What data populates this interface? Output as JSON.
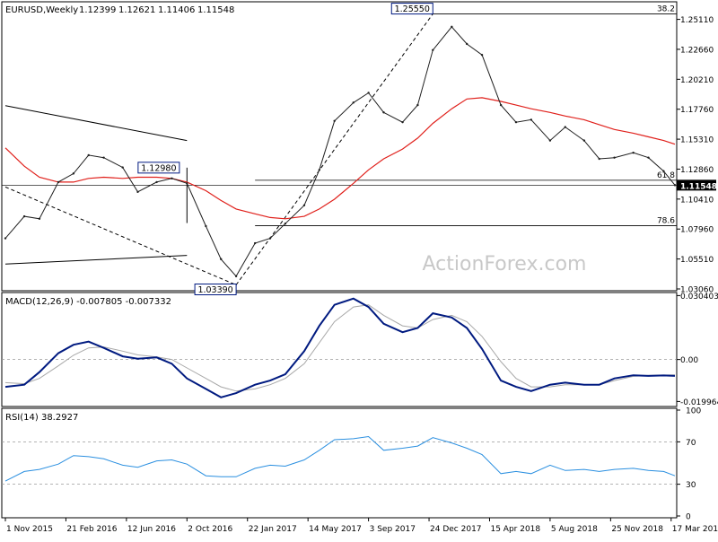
{
  "chart_data": {
    "type": "line",
    "title": "EURUSD,Weekly",
    "ohlc": {
      "open": "1.12399",
      "high": "1.12621",
      "low": "1.11406",
      "close": "1.11548"
    },
    "watermark": "ActionForex.com",
    "colors": {
      "price": "#1f1f1f",
      "sma": "#e0201b",
      "macd": "#001a80",
      "signal": "#a8a8a8",
      "rsi": "#2a8fe0",
      "label_box": "#001a80"
    },
    "x_ticks": [
      "1 Nov 2015",
      "21 Feb 2016",
      "12 Jun 2016",
      "2 Oct 2016",
      "22 Jan 2017",
      "14 May 2017",
      "3 Sep 2017",
      "24 Dec 2017",
      "15 Apr 2018",
      "5 Aug 2018",
      "25 Nov 2018",
      "17 Mar 2019"
    ],
    "x_start": "1 Nov 2015",
    "x_end": "24 Mar 2019",
    "price_panel": {
      "ylim": [
        1.0306,
        1.264
      ],
      "y_ticks": [
        "1.25110",
        "1.22660",
        "1.20210",
        "1.17760",
        "1.15310",
        "1.12860",
        "1.10410",
        "1.07960",
        "1.05510",
        "1.03060"
      ],
      "current_price_label": "1.11548",
      "current_price": 1.11548,
      "fib_levels": [
        {
          "label": "38.2",
          "value": 1.2555
        },
        {
          "label": "61.8",
          "value": 1.1195
        },
        {
          "label": "78.6",
          "value": 1.0823
        }
      ],
      "marked_highs_lows": [
        {
          "label": "1.25550",
          "value": 1.2555,
          "date": "31 Dec 2017"
        },
        {
          "label": "1.12980",
          "value": 1.1298,
          "date": "18 Sep 2016"
        },
        {
          "label": "1.03390",
          "value": 1.0339,
          "date": "1 Jan 2017"
        }
      ],
      "trendlines": [
        {
          "x": [
            "1 Nov 2015",
            "2 Oct 2016"
          ],
          "y": [
            1.1805,
            1.152
          ],
          "style": "solid"
        },
        {
          "x": [
            "1 Nov 2015",
            "2 Oct 2016"
          ],
          "y": [
            1.051,
            1.058
          ],
          "style": "solid"
        },
        {
          "x": [
            "1 Nov 2015",
            "1 Jan 2017"
          ],
          "y": [
            1.114,
            1.0339
          ],
          "style": "dashed"
        },
        {
          "x": [
            "1 Jan 2017",
            "31 Dec 2017"
          ],
          "y": [
            1.0339,
            1.2555
          ],
          "style": "dashed"
        }
      ],
      "resistance_lines": [
        {
          "x": [
            "2 Oct 2016",
            "2 Oct 2016"
          ],
          "y": [
            1.1298,
            1.0845
          ]
        }
      ],
      "close_series": {
        "dates": [
          "1 Nov 2015",
          "6 Dec 2015",
          "3 Jan 2016",
          "7 Feb 2016",
          "6 Mar 2016",
          "3 Apr 2016",
          "1 May 2016",
          "5 Jun 2016",
          "3 Jul 2016",
          "7 Aug 2016",
          "4 Sep 2016",
          "2 Oct 2016",
          "6 Nov 2016",
          "4 Dec 2016",
          "1 Jan 2017",
          "5 Feb 2017",
          "5 Mar 2017",
          "2 Apr 2017",
          "7 May 2017",
          "4 Jun 2017",
          "2 Jul 2017",
          "6 Aug 2017",
          "3 Sep 2017",
          "1 Oct 2017",
          "5 Nov 2017",
          "3 Dec 2017",
          "31 Dec 2017",
          "4 Feb 2018",
          "4 Mar 2018",
          "1 Apr 2018",
          "6 May 2018",
          "3 Jun 2018",
          "1 Jul 2018",
          "5 Aug 2018",
          "2 Sep 2018",
          "7 Oct 2018",
          "4 Nov 2018",
          "2 Dec 2018",
          "6 Jan 2019",
          "3 Feb 2019",
          "3 Mar 2019",
          "24 Mar 2019"
        ],
        "values": [
          1.072,
          1.09,
          1.088,
          1.118,
          1.125,
          1.14,
          1.138,
          1.13,
          1.11,
          1.118,
          1.121,
          1.117,
          1.082,
          1.055,
          1.041,
          1.068,
          1.072,
          1.084,
          1.099,
          1.128,
          1.168,
          1.183,
          1.191,
          1.175,
          1.167,
          1.181,
          1.226,
          1.245,
          1.231,
          1.222,
          1.181,
          1.167,
          1.169,
          1.152,
          1.163,
          1.152,
          1.137,
          1.138,
          1.142,
          1.138,
          1.127,
          1.1155
        ]
      },
      "sma_series": {
        "dates": [
          "1 Nov 2015",
          "6 Dec 2015",
          "3 Jan 2016",
          "7 Feb 2016",
          "6 Mar 2016",
          "3 Apr 2016",
          "1 May 2016",
          "5 Jun 2016",
          "3 Jul 2016",
          "7 Aug 2016",
          "4 Sep 2016",
          "2 Oct 2016",
          "6 Nov 2016",
          "4 Dec 2016",
          "1 Jan 2017",
          "5 Feb 2017",
          "5 Mar 2017",
          "2 Apr 2017",
          "7 May 2017",
          "4 Jun 2017",
          "2 Jul 2017",
          "6 Aug 2017",
          "3 Sep 2017",
          "1 Oct 2017",
          "5 Nov 2017",
          "3 Dec 2017",
          "31 Dec 2017",
          "4 Feb 2018",
          "4 Mar 2018",
          "1 Apr 2018",
          "6 May 2018",
          "3 Jun 2018",
          "1 Jul 2018",
          "5 Aug 2018",
          "2 Sep 2018",
          "7 Oct 2018",
          "4 Nov 2018",
          "2 Dec 2018",
          "6 Jan 2019",
          "3 Feb 2019",
          "3 Mar 2019",
          "24 Mar 2019"
        ],
        "values": [
          1.146,
          1.131,
          1.122,
          1.118,
          1.118,
          1.121,
          1.122,
          1.121,
          1.122,
          1.122,
          1.121,
          1.118,
          1.111,
          1.103,
          1.096,
          1.092,
          1.089,
          1.088,
          1.09,
          1.096,
          1.104,
          1.117,
          1.128,
          1.137,
          1.145,
          1.154,
          1.166,
          1.178,
          1.186,
          1.187,
          1.184,
          1.181,
          1.178,
          1.175,
          1.172,
          1.169,
          1.165,
          1.161,
          1.158,
          1.155,
          1.152,
          1.149
        ]
      }
    },
    "macd_panel": {
      "label": "MACD(12,26,9) -0.007805 -0.007332",
      "ylim": [
        -0.0215,
        0.031
      ],
      "y_ticks": [
        "0.030403",
        "0.00",
        "-0.019964"
      ],
      "zero_line": 0,
      "macd_series": {
        "dates": [
          "1 Nov 2015",
          "6 Dec 2015",
          "3 Jan 2016",
          "7 Feb 2016",
          "6 Mar 2016",
          "3 Apr 2016",
          "1 May 2016",
          "5 Jun 2016",
          "3 Jul 2016",
          "7 Aug 2016",
          "4 Sep 2016",
          "2 Oct 2016",
          "6 Nov 2016",
          "4 Dec 2016",
          "1 Jan 2017",
          "5 Feb 2017",
          "5 Mar 2017",
          "2 Apr 2017",
          "7 May 2017",
          "4 Jun 2017",
          "2 Jul 2017",
          "6 Aug 2017",
          "3 Sep 2017",
          "1 Oct 2017",
          "5 Nov 2017",
          "3 Dec 2017",
          "31 Dec 2017",
          "4 Feb 2018",
          "4 Mar 2018",
          "1 Apr 2018",
          "6 May 2018",
          "3 Jun 2018",
          "1 Jul 2018",
          "5 Aug 2018",
          "2 Sep 2018",
          "7 Oct 2018",
          "4 Nov 2018",
          "2 Dec 2018",
          "6 Jan 2019",
          "3 Feb 2019",
          "3 Mar 2019",
          "24 Mar 2019"
        ],
        "values": [
          -0.013,
          -0.012,
          -0.006,
          0.003,
          0.007,
          0.0085,
          0.0055,
          0.0015,
          0.0004,
          0.001,
          -0.002,
          -0.009,
          -0.014,
          -0.018,
          -0.016,
          -0.012,
          -0.01,
          -0.007,
          0.004,
          0.016,
          0.026,
          0.029,
          0.025,
          0.017,
          0.013,
          0.015,
          0.022,
          0.02,
          0.015,
          0.005,
          -0.01,
          -0.013,
          -0.015,
          -0.012,
          -0.011,
          -0.012,
          -0.012,
          -0.009,
          -0.0075,
          -0.0078,
          -0.0076,
          -0.0078
        ]
      },
      "signal_series": {
        "dates": [
          "1 Nov 2015",
          "6 Dec 2015",
          "3 Jan 2016",
          "7 Feb 2016",
          "6 Mar 2016",
          "3 Apr 2016",
          "1 May 2016",
          "5 Jun 2016",
          "3 Jul 2016",
          "7 Aug 2016",
          "4 Sep 2016",
          "2 Oct 2016",
          "6 Nov 2016",
          "4 Dec 2016",
          "1 Jan 2017",
          "5 Feb 2017",
          "5 Mar 2017",
          "2 Apr 2017",
          "7 May 2017",
          "4 Jun 2017",
          "2 Jul 2017",
          "6 Aug 2017",
          "3 Sep 2017",
          "1 Oct 2017",
          "5 Nov 2017",
          "3 Dec 2017",
          "31 Dec 2017",
          "4 Feb 2018",
          "4 Mar 2018",
          "1 Apr 2018",
          "6 May 2018",
          "3 Jun 2018",
          "1 Jul 2018",
          "5 Aug 2018",
          "2 Sep 2018",
          "7 Oct 2018",
          "4 Nov 2018",
          "2 Dec 2018",
          "6 Jan 2019",
          "3 Feb 2019",
          "3 Mar 2019",
          "24 Mar 2019"
        ],
        "values": [
          -0.011,
          -0.0115,
          -0.009,
          -0.003,
          0.002,
          0.0055,
          0.006,
          0.004,
          0.0022,
          0.0012,
          0.0,
          -0.004,
          -0.009,
          -0.013,
          -0.015,
          -0.014,
          -0.012,
          -0.009,
          -0.002,
          0.008,
          0.018,
          0.025,
          0.026,
          0.021,
          0.016,
          0.015,
          0.019,
          0.021,
          0.018,
          0.011,
          -0.001,
          -0.009,
          -0.013,
          -0.013,
          -0.012,
          -0.012,
          -0.012,
          -0.01,
          -0.008,
          -0.0076,
          -0.0074,
          -0.0073
        ]
      }
    },
    "rsi_panel": {
      "label": "RSI(14) 38.2927",
      "ylim": [
        0,
        100
      ],
      "y_ticks": [
        "100",
        "70",
        "30",
        "0"
      ],
      "guide_levels": [
        70,
        30
      ],
      "rsi_series": {
        "dates": [
          "1 Nov 2015",
          "6 Dec 2015",
          "3 Jan 2016",
          "7 Feb 2016",
          "6 Mar 2016",
          "3 Apr 2016",
          "1 May 2016",
          "5 Jun 2016",
          "3 Jul 2016",
          "7 Aug 2016",
          "4 Sep 2016",
          "2 Oct 2016",
          "6 Nov 2016",
          "4 Dec 2016",
          "1 Jan 2017",
          "5 Feb 2017",
          "5 Mar 2017",
          "2 Apr 2017",
          "7 May 2017",
          "4 Jun 2017",
          "2 Jul 2017",
          "6 Aug 2017",
          "3 Sep 2017",
          "1 Oct 2017",
          "5 Nov 2017",
          "3 Dec 2017",
          "31 Dec 2017",
          "4 Feb 2018",
          "4 Mar 2018",
          "1 Apr 2018",
          "6 May 2018",
          "3 Jun 2018",
          "1 Jul 2018",
          "5 Aug 2018",
          "2 Sep 2018",
          "7 Oct 2018",
          "4 Nov 2018",
          "2 Dec 2018",
          "6 Jan 2019",
          "3 Feb 2019",
          "3 Mar 2019",
          "24 Mar 2019"
        ],
        "values": [
          33,
          42,
          44,
          49,
          57,
          56,
          54,
          48,
          46,
          52,
          53,
          49,
          38,
          37,
          37,
          45,
          48,
          47,
          53,
          62,
          72,
          73,
          75,
          62,
          64,
          66,
          74,
          69,
          64,
          58,
          40,
          42,
          40,
          48,
          43,
          44,
          42,
          44,
          45,
          43,
          42,
          38
        ]
      }
    }
  }
}
